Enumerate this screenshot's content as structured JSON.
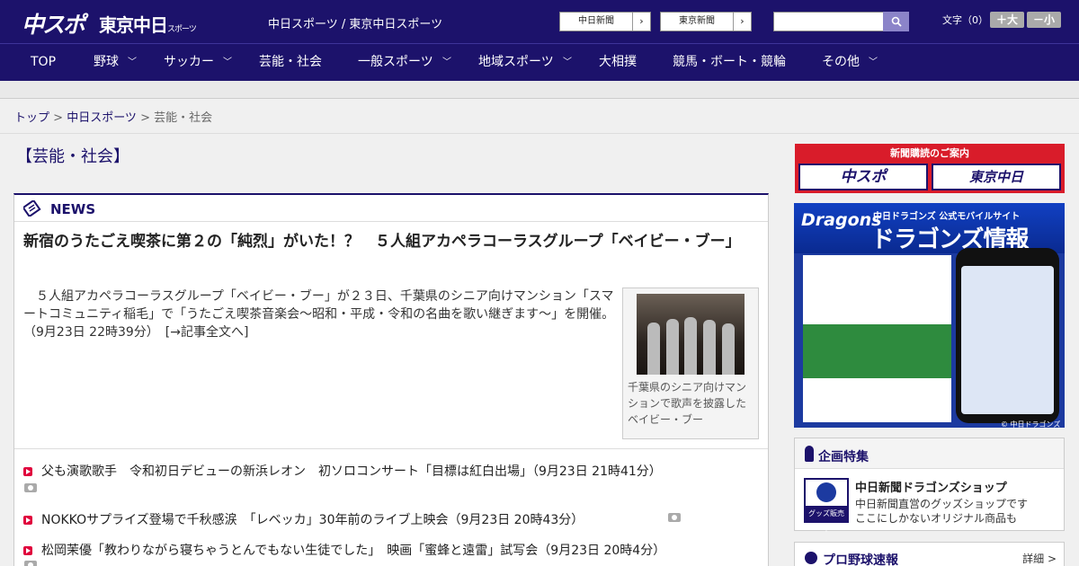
{
  "header": {
    "logo_chuspo": "中スポ",
    "logo_tokyo": "東京中日",
    "logo_tokyo_small": "スポーツ",
    "sitenames": "中日スポーツ / 東京中日スポーツ",
    "btn_chunichi": "中日新聞",
    "btn_tokyo": "東京新聞",
    "arrow": "›",
    "search_icon": "search-icon",
    "fontsize_label": "文字（0）",
    "font_larger": "＋大",
    "font_smaller": "－小"
  },
  "nav": {
    "items": [
      "TOP",
      "野球",
      "サッカー",
      "芸能・社会",
      "一般スポーツ",
      "地域スポーツ",
      "大相撲",
      "競馬・ボート・競輪",
      "その他"
    ],
    "chevron": "﹀"
  },
  "breadcrumb": {
    "top": "トップ",
    "sep": " > ",
    "chuspo": "中日スポーツ",
    "current": "芸能・社会"
  },
  "page_title": "【芸能・社会】",
  "news": {
    "label": "NEWS",
    "headline": "新宿のうたごえ喫茶に第２の「純烈」がいた！？　５人組アカペラコーラスグループ「ベイビー・ブー」",
    "lead": "　５人組アカペラコーラスグループ「ベイビー・ブー」が２３日、千葉県のシニア向けマンション「スマートコミュニティ稲毛」で「うたごえ喫茶音楽会～昭和・平成・令和の名曲を歌い継ぎます～」を開催。（9月23日 22時39分）　[→記事全文へ]",
    "photo_caption": "千葉県のシニア向けマンションで歌声を披露したベイビー・ブー",
    "items": [
      "父も演歌歌手　令和初日デビューの新浜レオン　初ソロコンサート「目標は紅白出場」（9月23日 21時41分）",
      "NOKKOサプライズ登場で千秋感涙　「レベッカ」30年前のライブ上映会（9月23日 20時43分）",
      "松岡茉優「教わりながら寝ちゃうとんでもない生徒でした」　映画「蜜蜂と遠雷」試写会（9月23日 20時4分）"
    ]
  },
  "sidebar": {
    "subscribe_title": "新聞購読のご案内",
    "subscribe_chuspo": "中スポ",
    "subscribe_tokyo": "東京中日",
    "dragons_logo": "Dragons",
    "dragons_sub": "中日ドラゴンズ 公式モバイルサイト",
    "dragons_title": "ドラゴンズ情報",
    "dragons_copy": "© 中日ドラゴンズ",
    "planning_title": "企画特集",
    "shop_caption": "グッズ販売中",
    "shop_name": "中日新聞ドラゴンズショップ",
    "shop_desc1": "中日新聞直営のグッズショップです",
    "shop_desc2": "ここにしかないオリジナル商品も",
    "scores_title": "プロ野球速報",
    "scores_more": "詳細 >"
  },
  "colors": {
    "brand_navy": "#1c126b",
    "accent_red": "#e0003c"
  }
}
